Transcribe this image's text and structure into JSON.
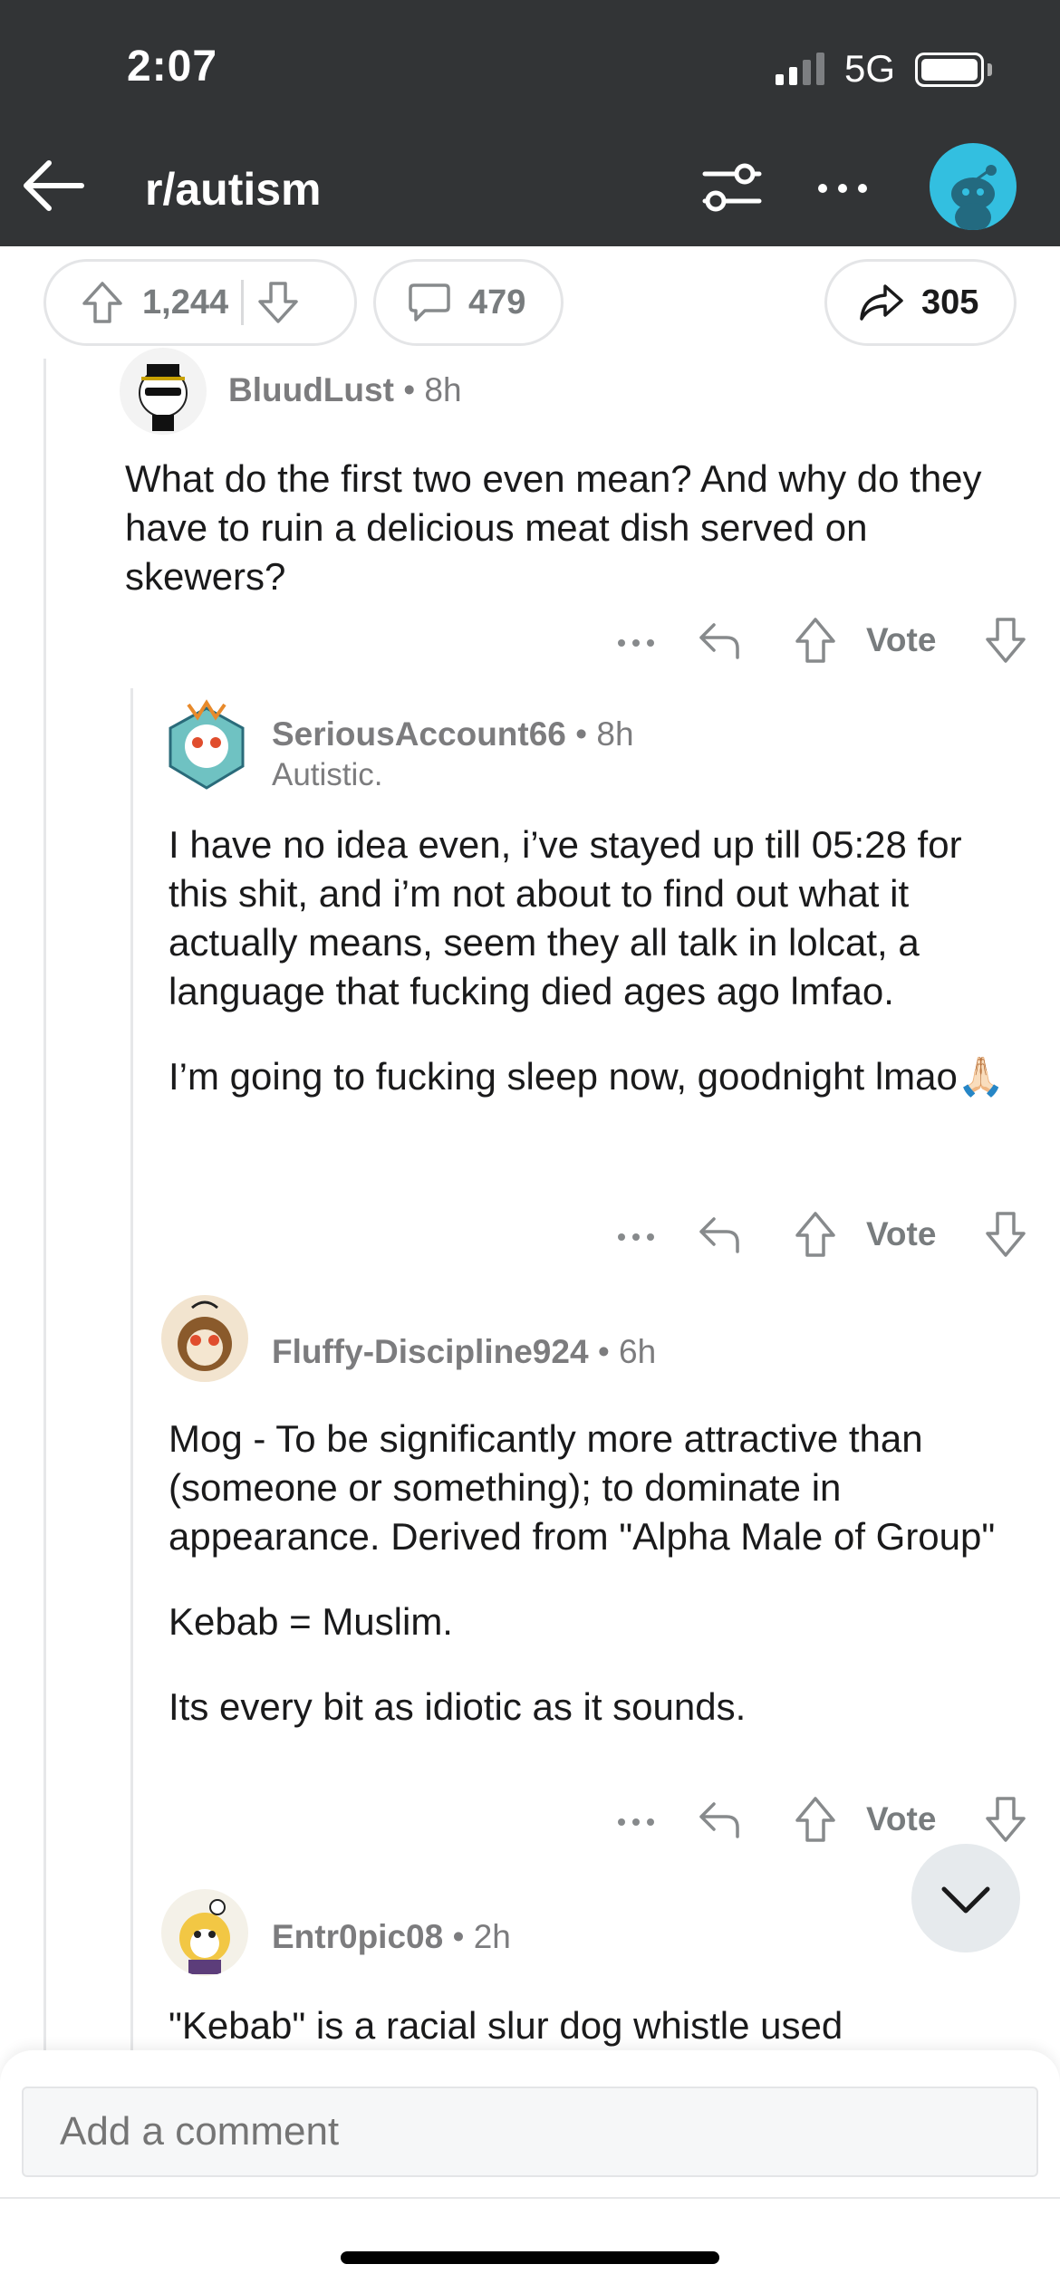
{
  "status_bar": {
    "time": "2:07",
    "network": "5G"
  },
  "header": {
    "subreddit": "r/autism",
    "icons": {
      "back": "back-arrow-icon",
      "filter": "sort-filter-icon",
      "more": "more-dots-icon",
      "avatar": "snoo-avatar"
    },
    "avatar_color": "#33bfe0",
    "background": "#323436"
  },
  "post_actions": {
    "upvotes": "1,244",
    "comments": "479",
    "shares": "305"
  },
  "comments": [
    {
      "user": "BluudLust",
      "age": "8h",
      "flair": "",
      "paragraphs": [
        "What do the first two even mean? And why do they have to ruin a delicious meat dish served on skewers?"
      ],
      "vote_label": "Vote"
    },
    {
      "user": "SeriousAccount66",
      "age": "8h",
      "flair": "Autistic.",
      "paragraphs": [
        "I have no idea even, i’ve stayed up till 05:28 for this shit, and i’m not about to find out what it actually means, seem they all talk in lolcat, a language that fucking died ages ago lmfao.",
        "I’m going to fucking sleep now, goodnight lmao🙏🏻"
      ],
      "vote_label": "Vote"
    },
    {
      "user": "Fluffy-Discipline924",
      "age": "6h",
      "flair": "",
      "paragraphs": [
        "Mog - To be significantly more attractive than (someone or something); to dominate in appearance. Derived from \"Alpha Male of Group\"",
        "Kebab = Muslim.",
        "Its every bit as idiotic as it sounds."
      ],
      "vote_label": "Vote"
    },
    {
      "user": "Entr0pic08",
      "age": "2h",
      "flair": "",
      "paragraphs": [
        "\"Kebab\" is a racial slur dog whistle used"
      ],
      "vote_label": ""
    }
  ],
  "composer": {
    "placeholder": "Add a comment"
  }
}
